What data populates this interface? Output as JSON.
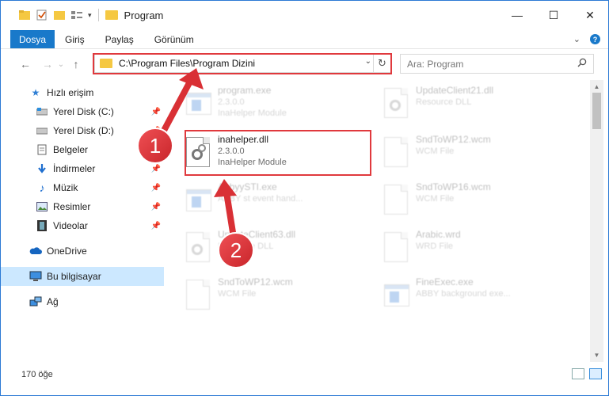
{
  "window": {
    "title": "Program",
    "controls": {
      "minimize": "—",
      "maximize": "☐",
      "close": "✕"
    }
  },
  "ribbon": {
    "file_tab": "Dosya",
    "tabs": [
      "Giriş",
      "Paylaş",
      "Görünüm"
    ],
    "expand": "⌄",
    "help": "?"
  },
  "nav": {
    "back": "←",
    "forward": "→",
    "recent": "⌄",
    "up": "↑",
    "address": "C:\\Program Files\\Program Dizini",
    "address_dropdown": "⌄",
    "refresh": "↻",
    "search_placeholder": "Ara: Program",
    "search_icon": "⚲"
  },
  "sidebar": {
    "items": [
      {
        "label": "Hızlı erişim",
        "icon": "star-icon"
      },
      {
        "label": "Yerel Disk (C:)",
        "icon": "drive-icon",
        "pinned": true
      },
      {
        "label": "Yerel Disk (D:)",
        "icon": "drive-icon",
        "pinned": true
      },
      {
        "label": "Belgeler",
        "icon": "documents-icon",
        "pinned": true
      },
      {
        "label": "İndirmeler",
        "icon": "downloads-icon",
        "pinned": true
      },
      {
        "label": "Müzik",
        "icon": "music-icon",
        "pinned": true
      },
      {
        "label": "Resimler",
        "icon": "pictures-icon",
        "pinned": true
      },
      {
        "label": "Videolar",
        "icon": "videos-icon",
        "pinned": true
      },
      {
        "label": "OneDrive",
        "icon": "cloud-icon"
      },
      {
        "label": "Bu bilgisayar",
        "icon": "computer-icon",
        "selected": true
      },
      {
        "label": "Ağ",
        "icon": "network-icon"
      }
    ]
  },
  "files": [
    {
      "name": "program.exe",
      "line2": "2.3.0.0",
      "line3": "InaHelper Module",
      "kind": "exe",
      "faded": true
    },
    {
      "name": "UpdateClient21.dll",
      "line2": "Resource DLL",
      "line3": "",
      "kind": "dll",
      "faded": true
    },
    {
      "name": "inahelper.dll",
      "line2": "2.3.0.0",
      "line3": "InaHelper Module",
      "kind": "dll",
      "faded": false
    },
    {
      "name": "SndToWP12.wcm",
      "line2": "WCM File",
      "line3": "",
      "kind": "doc",
      "faded": true
    },
    {
      "name": "AbbyySTI.exe",
      "line2": "ABBY st event hand...",
      "line3": "",
      "kind": "exe",
      "faded": true
    },
    {
      "name": "SndToWP16.wcm",
      "line2": "WCM File",
      "line3": "",
      "kind": "doc",
      "faded": true
    },
    {
      "name": "UpdateClient63.dll",
      "line2": "Resource DLL",
      "line3": "",
      "kind": "dll",
      "faded": true
    },
    {
      "name": "Arabic.wrd",
      "line2": "WRD File",
      "line3": "",
      "kind": "doc",
      "faded": true
    },
    {
      "name": "SndToWP12.wcm",
      "line2": "WCM File",
      "line3": "",
      "kind": "doc",
      "faded": true
    },
    {
      "name": "FineExec.exe",
      "line2": "ABBY background exe...",
      "line3": "",
      "kind": "exe",
      "faded": true
    }
  ],
  "status": {
    "count": "170 öğe"
  },
  "annotations": {
    "step1": "1",
    "step2": "2"
  },
  "colors": {
    "accent": "#1979ca",
    "highlight": "#e0393d",
    "selected_bg": "#cce8ff"
  }
}
